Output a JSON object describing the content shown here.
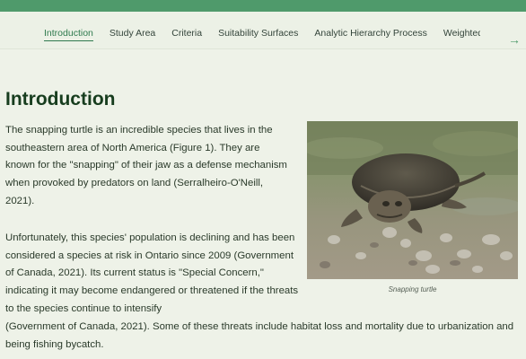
{
  "nav": {
    "tabs": [
      {
        "label": "Introduction",
        "active": true
      },
      {
        "label": "Study Area"
      },
      {
        "label": "Criteria"
      },
      {
        "label": "Suitability Surfaces"
      },
      {
        "label": "Analytic Hierarchy Process"
      },
      {
        "label": "Weighted C"
      }
    ],
    "next_icon": "arrow-right-icon"
  },
  "colors": {
    "accent": "#4f9a6b",
    "heading": "#173d1e",
    "background": "#eef2e8"
  },
  "page": {
    "title": "Introduction",
    "paragraph1": "The snapping turtle is an incredible species that lives in the southeastern area of North America (Figure 1). They are known for the \"snapping\" of their jaw as a defense mechanism when provoked by predators on land (Serralheiro-O'Neill, 2021).",
    "paragraph2_part1": "Unfortunately, this species' population is declining and has been considered a species at risk in Ontario since 2009 (Government of Canada, 2021). Its current status is \"Special Concern,\" indicating it may become endangered or threatened if the threats to the species continue to intensify",
    "paragraph2_part2": "(Government of Canada, 2021). Some of these threats include habitat loss and mortality due to urbanization and being fishing bycatch.",
    "figure_caption": "Snapping turtle"
  }
}
